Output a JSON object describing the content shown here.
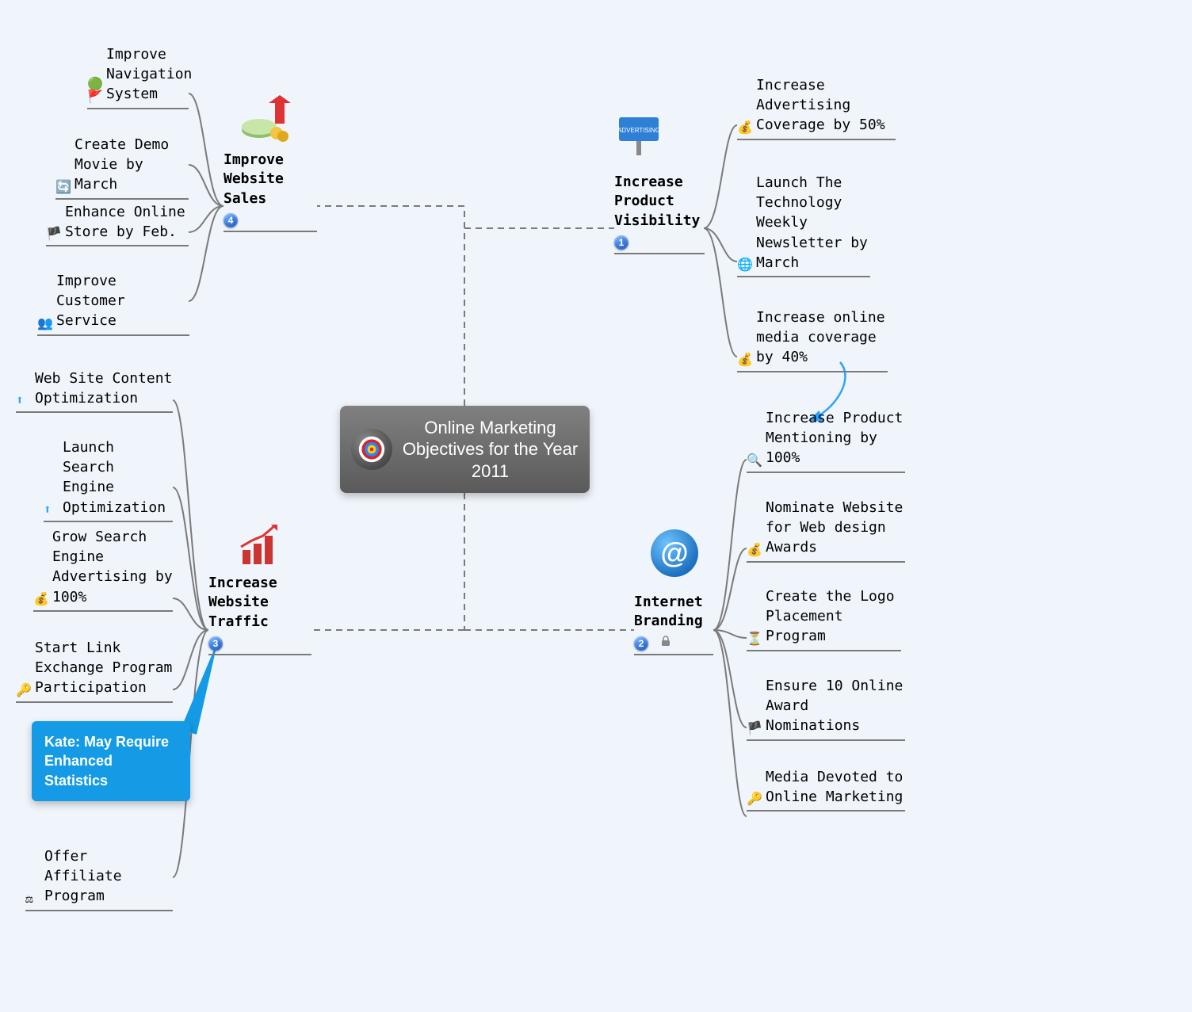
{
  "center": {
    "title": "Online Marketing Objectives for the Year 2011",
    "icon": "target"
  },
  "branches": {
    "improve_website_sales": {
      "label": "Improve\nWebsite\nSales",
      "priority": "4",
      "image": "money-up-arrow",
      "children": [
        {
          "icon": "flag-green",
          "text": "Improve\nNavigation\nSystem"
        },
        {
          "icon": "globe-refresh",
          "text": "Create Demo\nMovie by March"
        },
        {
          "icon": "flag-black",
          "text": "Enhance Online\nStore by Feb."
        },
        {
          "icon": "people",
          "text": "Improve Customer\nService"
        }
      ]
    },
    "increase_website_traffic": {
      "label": "Increase\nWebsite\nTraffic",
      "priority": "3",
      "image": "chart-up",
      "children": [
        {
          "icon": "arrow-up-blue",
          "text": "Web Site Content\nOptimization"
        },
        {
          "icon": "arrow-up-blue",
          "text": "Launch Search\nEngine\nOptimization"
        },
        {
          "icon": "coin-dollar",
          "text": "Grow Search\nEngine\nAdvertising by\n100%"
        },
        {
          "icon": "key",
          "text": "Start Link\nExchange Program\nParticipation"
        },
        {
          "icon": "scale",
          "text": "Offer Affiliate\nProgram"
        }
      ],
      "note": {
        "author": "Kate",
        "text": "May Require Enhanced Statistics"
      }
    },
    "increase_product_visibility": {
      "label": "Increase\nProduct\nVisibility",
      "priority": "1",
      "image": "advertising-sign",
      "children": [
        {
          "icon": "coin-dollar",
          "text": "Increase\nAdvertising\nCoverage by 50%"
        },
        {
          "icon": "globe",
          "text": "Launch The\nTechnology\nWeekly\nNewsletter by\nMarch"
        },
        {
          "icon": "coin-dollar",
          "text": "Increase online\nmedia coverage\nby 40%"
        }
      ]
    },
    "internet_branding": {
      "label": "Internet\nBranding",
      "priority": "2",
      "locked": true,
      "image": "at-sign-sphere",
      "children": [
        {
          "icon": "magnifier",
          "text": "Increase Product\nMentioning by\n100%"
        },
        {
          "icon": "coin-dollar",
          "text": "Nominate Website\nfor Web design\nAwards"
        },
        {
          "icon": "hourglass",
          "text": "Create the Logo\nPlacement\nProgram"
        },
        {
          "icon": "flag-black",
          "text": "Ensure 10 Online\nAward\nNominations"
        },
        {
          "icon": "key",
          "text": "Media Devoted to\nOnline Marketing"
        }
      ]
    }
  },
  "relationships": [
    {
      "from": "increase_product_visibility.children.2",
      "to": "internet_branding.children.0",
      "type": "arrow"
    }
  ]
}
